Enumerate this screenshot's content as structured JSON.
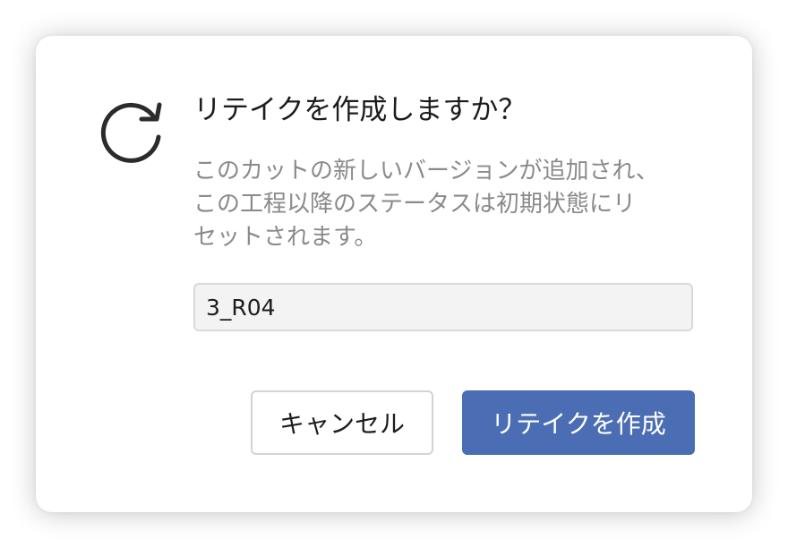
{
  "dialog": {
    "icon": "refresh-icon",
    "title": "リテイクを作成しますか？",
    "description_lines": [
      "このカットの新しいバージョンが追加され、",
      "この工程以降のステータスは初期状態にリ",
      "セットされます。"
    ],
    "version_input": {
      "value": "3_R04"
    },
    "buttons": {
      "cancel_label": "キャンセル",
      "confirm_label": "リテイクを作成"
    }
  },
  "colors": {
    "primary": "#4a6db4",
    "title_text": "#1c1c1c",
    "muted_text": "#8a8a8a",
    "input_bg": "#f3f3f3"
  }
}
